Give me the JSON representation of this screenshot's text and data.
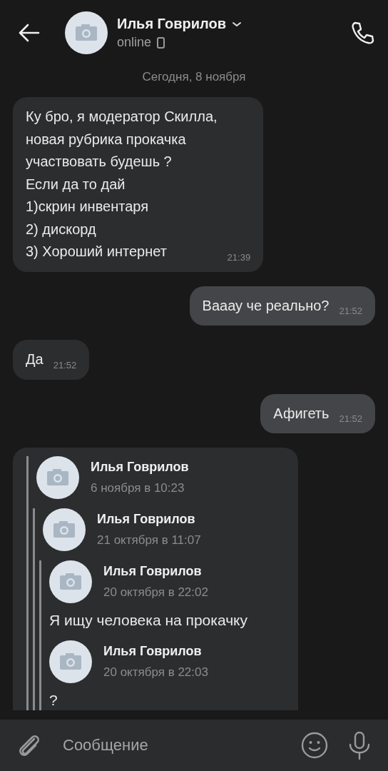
{
  "header": {
    "title": "Илья Говрилов",
    "status": "online"
  },
  "date_separator": "Сегодня, 8 ноября",
  "messages": [
    {
      "kind": "text",
      "outgoing": false,
      "text": "Ку бро, я модератор Скилла,\nновая рубрика прокачка\nучаствовать будешь ?\nЕсли да то дай\n1)скрин инвентаря\n2) дискорд\n3) Хороший интернет",
      "time": "21:39"
    },
    {
      "kind": "text",
      "outgoing": true,
      "text": "Вааау че реально?",
      "time": "21:52"
    },
    {
      "kind": "text",
      "outgoing": false,
      "text": "Да",
      "time": "21:52"
    },
    {
      "kind": "text",
      "outgoing": true,
      "text": "Афигеть",
      "time": "21:52"
    },
    {
      "kind": "forwarded",
      "outgoing": false,
      "forwarded": [
        {
          "author": "Илья Говрилов",
          "date": "6 ноября в 10:23",
          "forwarded": [
            {
              "author": "Илья Говрилов",
              "date": "21 октября в 11:07",
              "forwarded": [
                {
                  "author": "Илья Говрилов",
                  "date": "20 октября в 22:02",
                  "text": "Я ищу человека на прокачку"
                },
                {
                  "author": "Илья Говрилов",
                  "date": "20 октября в 22:03",
                  "text": "?"
                }
              ]
            }
          ]
        }
      ]
    }
  ],
  "composer": {
    "placeholder": "Сообщение"
  }
}
